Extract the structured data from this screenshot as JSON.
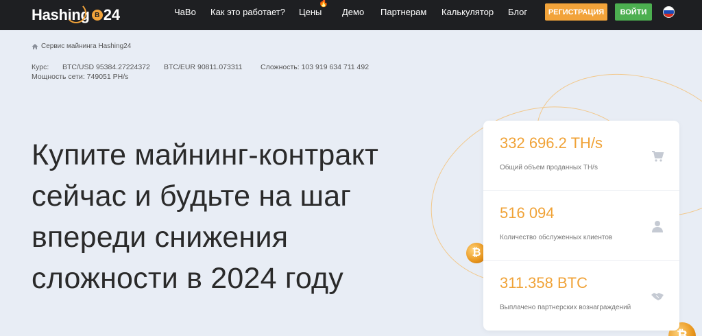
{
  "header": {
    "logo_text": "Hashing",
    "logo_badge": "B",
    "logo_num": "24",
    "nav": [
      {
        "label": "ЧаВо"
      },
      {
        "label": "Как это работает?"
      },
      {
        "label": "Цены"
      },
      {
        "label": "Демо"
      },
      {
        "label": "Партнерам"
      },
      {
        "label": "Калькулятор"
      },
      {
        "label": "Блог"
      }
    ],
    "fire_icon": "🔥",
    "register_label": "РЕГИСТРАЦИЯ",
    "login_label": "ВОЙТИ"
  },
  "breadcrumb": {
    "label": "Сервис майнинга Hashing24"
  },
  "rates": {
    "label": "Курс:",
    "btc_usd": "BTC/USD 95384.27224372",
    "btc_eur": "BTC/EUR 90811.073311",
    "difficulty": "Сложность: 103 919 634 711 492",
    "network_power": "Мощность сети: 749051 PH/s"
  },
  "hero": {
    "title": "Купите майнинг-контракт сейчас и будьте на шаг впереди снижения сложности в 2024 году"
  },
  "stats": [
    {
      "value": "332 696.2 TH/s",
      "label": "Общий объем проданных TH/s",
      "icon": "cart-icon"
    },
    {
      "value": "516 094",
      "label": "Количество обслуженных клиентов",
      "icon": "user-icon"
    },
    {
      "value": "311.358 BTC",
      "label": "Выплачено партнерских вознаграждений",
      "icon": "handshake-icon"
    }
  ],
  "colors": {
    "accent": "#f0a236",
    "topbar": "#1e1f22",
    "background": "#e8edf5",
    "login": "#4caf50"
  }
}
